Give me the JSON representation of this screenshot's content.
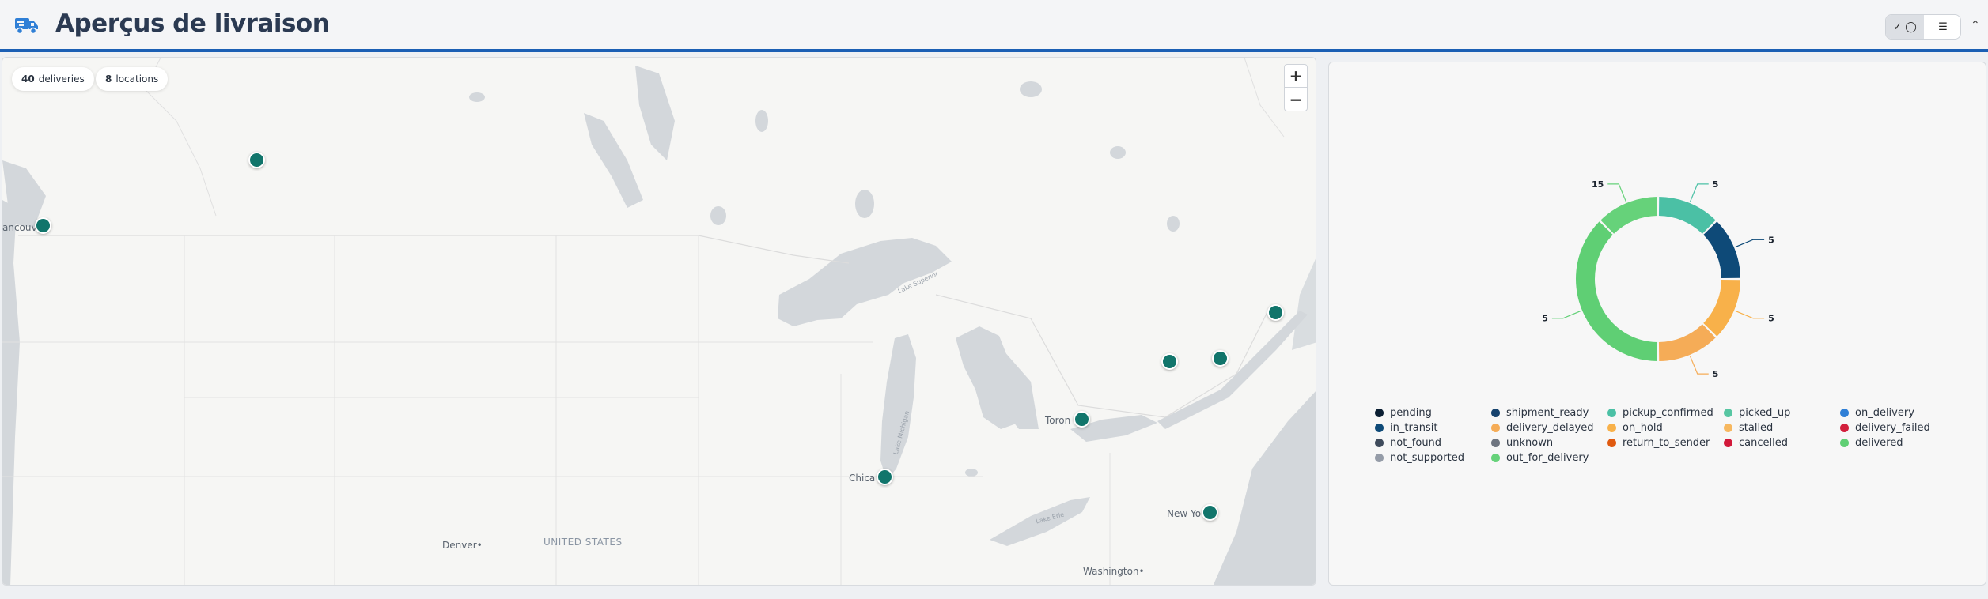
{
  "header": {
    "title": "Aperçus de livraison",
    "toggle_chart_icon": "✓ ◯",
    "toggle_list_icon": "☰",
    "collapse_icon": "⌃",
    "accent": "#1b5fb4"
  },
  "map": {
    "chips": [
      {
        "count": "40",
        "label": "deliveries"
      },
      {
        "count": "8",
        "label": "locations"
      }
    ],
    "zoom_in": "+",
    "zoom_out": "−",
    "labels": {
      "vancouver": "ancouv",
      "toronto": "Toron",
      "chicago": "Chica",
      "new_york": "New Yo",
      "denver": "Denver•",
      "washington": "Washington•",
      "united_states": "UNITED STATES",
      "lake_superior": "Lake Superior",
      "lake_michigan": "Lake Michigan",
      "lake_erie": "Lake Erie"
    },
    "marker_color": "#11756b"
  },
  "chart_data": {
    "type": "pie",
    "donut": true,
    "slices": [
      {
        "label": "pickup_confirmed",
        "value": 5,
        "color": "#4bc0a5"
      },
      {
        "label": "in_transit",
        "value": 5,
        "color": "#0e4a78"
      },
      {
        "label": "on_hold",
        "value": 5,
        "color": "#f8b14a"
      },
      {
        "label": "delivery_delayed",
        "value": 5,
        "color": "#f5ac57"
      },
      {
        "label": "delivered",
        "value": 15,
        "color": "#5fcf74"
      },
      {
        "label": "out_for_delivery",
        "value": 5,
        "color": "#66d27a"
      }
    ],
    "data_labels": [
      "5",
      "5",
      "5",
      "5",
      "5",
      "15"
    ],
    "legend": [
      {
        "label": "pending",
        "color": "#0b1f33"
      },
      {
        "label": "shipment_ready",
        "color": "#16436e"
      },
      {
        "label": "pickup_confirmed",
        "color": "#4bc0a5"
      },
      {
        "label": "picked_up",
        "color": "#57c6a2"
      },
      {
        "label": "on_delivery",
        "color": "#2f7fd6"
      },
      {
        "label": "in_transit",
        "color": "#0e4a78"
      },
      {
        "label": "delivery_delayed",
        "color": "#f5ac57"
      },
      {
        "label": "on_hold",
        "color": "#f8b14a"
      },
      {
        "label": "stalled",
        "color": "#f7b860"
      },
      {
        "label": "delivery_failed",
        "color": "#d21f3c"
      },
      {
        "label": "not_found",
        "color": "#3f4b5c"
      },
      {
        "label": "unknown",
        "color": "#6e7580"
      },
      {
        "label": "return_to_sender",
        "color": "#e05a10"
      },
      {
        "label": "cancelled",
        "color": "#d2193a"
      },
      {
        "label": "delivered",
        "color": "#5fcf74"
      },
      {
        "label": "not_supported",
        "color": "#959ca8"
      },
      {
        "label": "out_for_delivery",
        "color": "#66d27a"
      }
    ]
  }
}
